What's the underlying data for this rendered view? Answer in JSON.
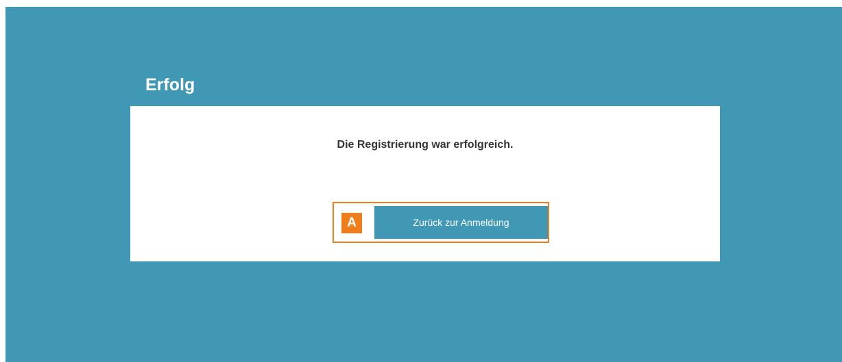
{
  "page": {
    "title": "Erfolg",
    "message": "Die Registrierung war erfolgreich.",
    "button": {
      "badge": "A",
      "label": "Zurück zur Anmeldung"
    }
  },
  "colors": {
    "background": "#4098b4",
    "panel": "#ffffff",
    "accent": "#f07d1c",
    "button": "#4098b4"
  }
}
